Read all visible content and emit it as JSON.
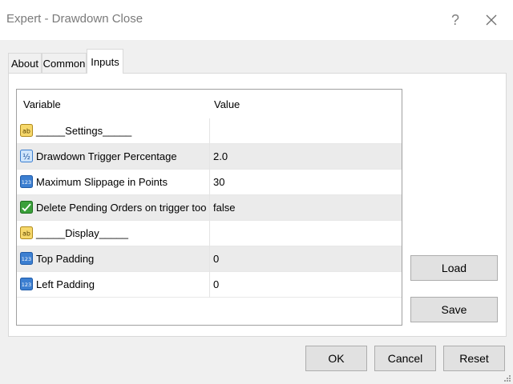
{
  "window": {
    "title": "Expert - Drawdown Close",
    "help_label": "?"
  },
  "tabs": [
    {
      "label": "About",
      "active": false
    },
    {
      "label": "Common",
      "active": false
    },
    {
      "label": "Inputs",
      "active": true
    }
  ],
  "grid": {
    "columns": [
      "Variable",
      "Value"
    ],
    "rows": [
      {
        "icon": "ab-icon",
        "variable": "_____Settings_____",
        "value": ""
      },
      {
        "icon": "fraction-icon",
        "variable": "Drawdown Trigger Percentage",
        "value": "2.0"
      },
      {
        "icon": "integer-icon",
        "variable": "Maximum Slippage in Points",
        "value": "30"
      },
      {
        "icon": "boolean-icon",
        "variable": "Delete Pending Orders on trigger too",
        "value": "false"
      },
      {
        "icon": "ab-icon",
        "variable": "_____Display_____",
        "value": ""
      },
      {
        "icon": "integer-icon",
        "variable": "Top Padding",
        "value": "0"
      },
      {
        "icon": "integer-icon",
        "variable": "Left Padding",
        "value": "0"
      }
    ]
  },
  "side_buttons": {
    "load": "Load",
    "save": "Save"
  },
  "footer_buttons": {
    "ok": "OK",
    "cancel": "Cancel",
    "reset": "Reset"
  },
  "icon_labels": {
    "ab": "ab",
    "fraction": "½",
    "integer": "123"
  },
  "colors": {
    "string_icon": "#f6d86b",
    "number_icon": "#3c7fd1",
    "bool_icon": "#3aa03a"
  }
}
